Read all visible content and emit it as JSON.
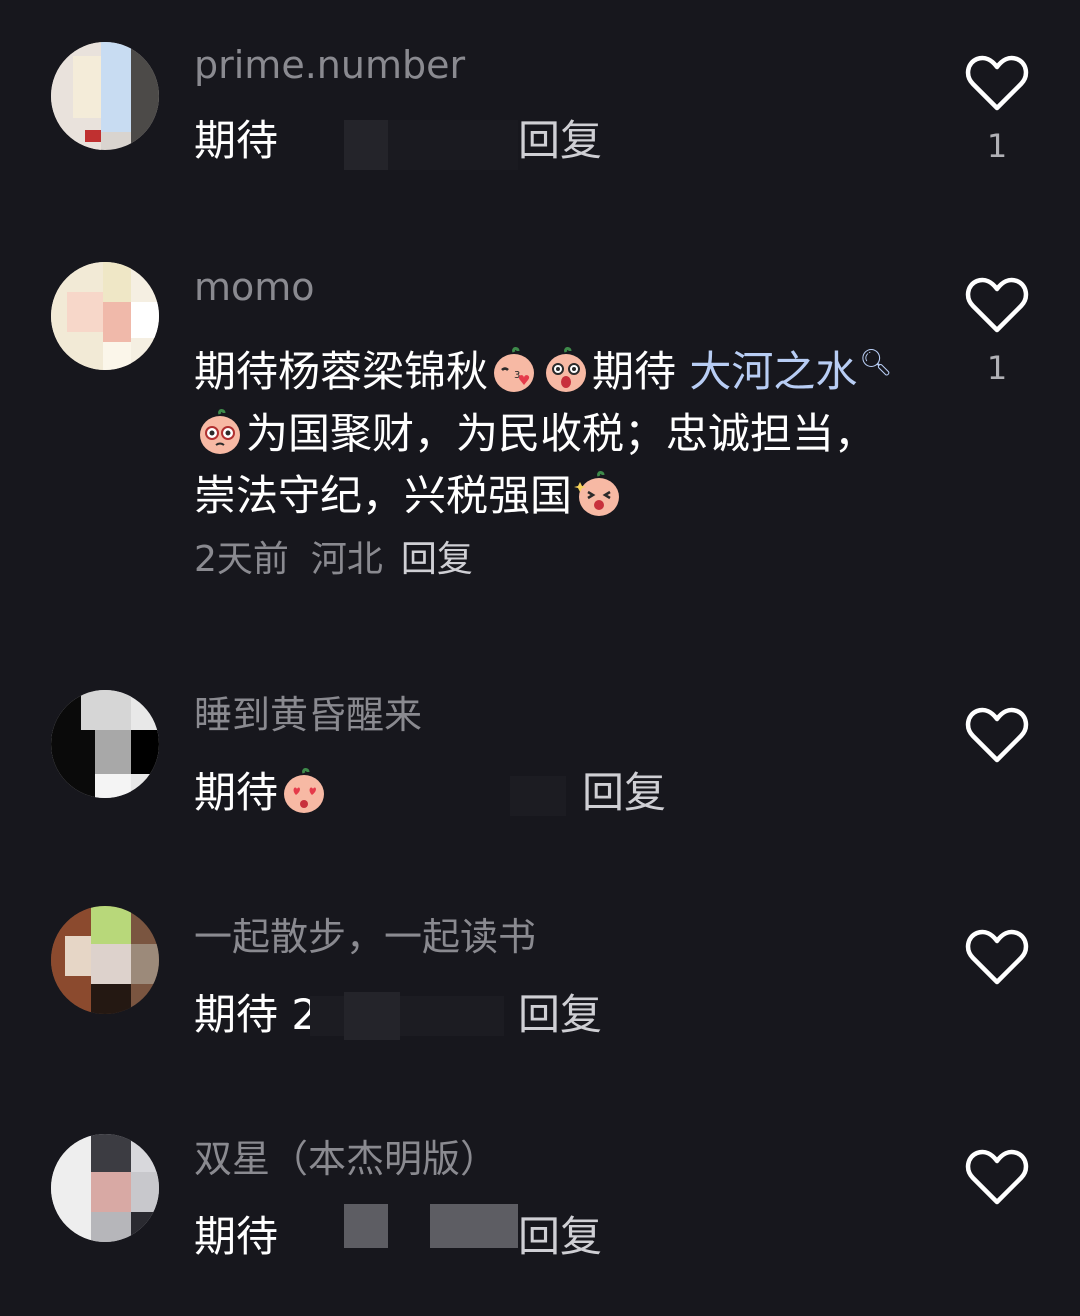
{
  "comments": [
    {
      "username": "prime.number",
      "text_start": "期待",
      "text_end": "回复",
      "like_count": "1"
    },
    {
      "username": "momo",
      "text_part1": "期待杨蓉梁锦秋",
      "text_part2": "期待 ",
      "link_text": "大河之水",
      "text_part3": "为国聚财，为民收税；忠诚担当，崇法守纪，兴税强国",
      "time": "2天前",
      "region": "河北",
      "reply": "回复",
      "like_count": "1"
    },
    {
      "username": "睡到黄昏醒来",
      "text_start": "期待",
      "text_end": "回复"
    },
    {
      "username": "一起散步，一起读书",
      "text_start": "期待 2",
      "text_end": "回复"
    },
    {
      "username": "双星（本杰明版）",
      "text_start": "期待",
      "text_end": "回复"
    }
  ],
  "icons": {
    "like": "heart-outline-icon",
    "link_search": "search-icon"
  },
  "colors": {
    "background": "#17171d",
    "username": "#8a8a90",
    "text": "#ffffff",
    "link": "#b8cdf4",
    "icon": "#ffffff"
  }
}
